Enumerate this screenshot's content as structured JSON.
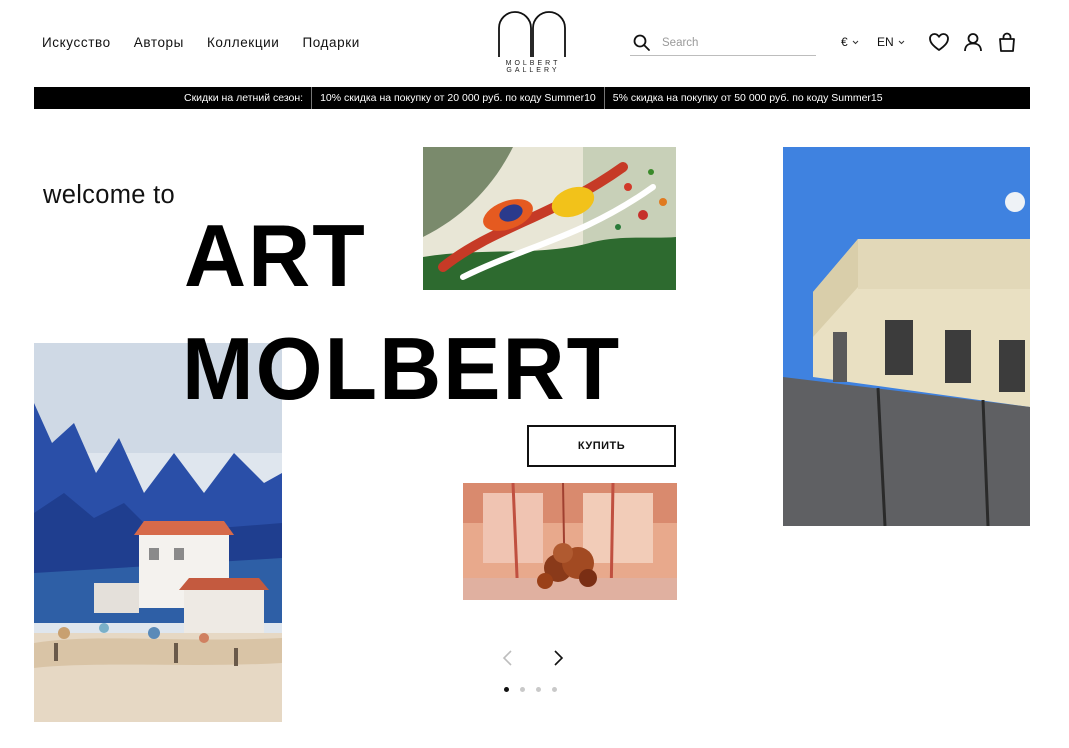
{
  "nav": {
    "items": [
      {
        "label": "Искусство"
      },
      {
        "label": "Авторы"
      },
      {
        "label": "Коллекции"
      },
      {
        "label": "Подарки"
      }
    ]
  },
  "logo": {
    "line1": "MOLBERT",
    "line2": "GALLERY"
  },
  "search": {
    "placeholder": "Search"
  },
  "currency": {
    "selected": "€"
  },
  "language": {
    "selected": "EN"
  },
  "promo": {
    "title": "Скидки на летний сезон:",
    "offers": [
      {
        "text": "10% скидка на покупку от 20 000 руб. по коду Summer10"
      },
      {
        "text": "5% скидка на покупку от 50 000 руб. по коду Summer15"
      }
    ]
  },
  "hero": {
    "welcome": "welcome to",
    "headline_line1": "ART",
    "headline_line2": "MOLBERT",
    "buy_label": "КУПИТЬ"
  },
  "carousel": {
    "slide_count": 4,
    "active_index": 0
  },
  "colors": {
    "promo_bg": "#000000",
    "text": "#111111",
    "sky_blue": "#3f82e0"
  }
}
